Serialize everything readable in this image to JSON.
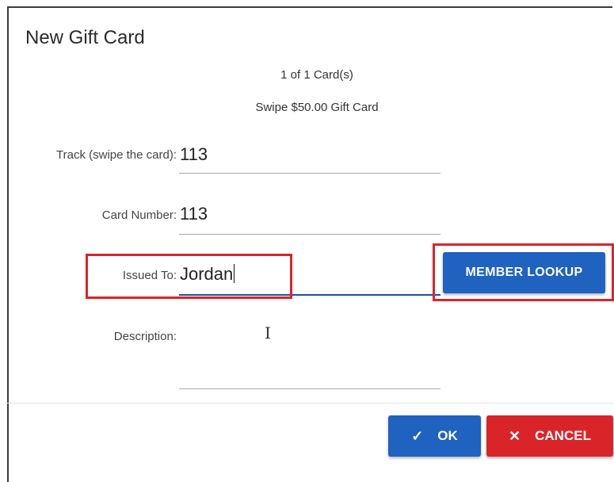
{
  "dialog": {
    "title": "New Gift Card",
    "card_count": "1 of 1 Card(s)",
    "instruction": "Swipe $50.00 Gift Card"
  },
  "fields": {
    "track": {
      "label": "Track (swipe the card):",
      "value": "113"
    },
    "card_number": {
      "label": "Card Number:",
      "value": "113"
    },
    "issued_to": {
      "label": "Issued To:",
      "value": "Jordan"
    },
    "description": {
      "label": "Description:",
      "value": ""
    }
  },
  "buttons": {
    "member_lookup": "MEMBER LOOKUP",
    "ok": "OK",
    "cancel": "CANCEL"
  },
  "icons": {
    "ok": "check-icon",
    "cancel": "close-icon",
    "cursor": "text-cursor-icon"
  },
  "colors": {
    "primary": "#1f62bf",
    "danger": "#d9252a",
    "highlight": "#d9252a",
    "active_underline": "#1e4e9a"
  }
}
